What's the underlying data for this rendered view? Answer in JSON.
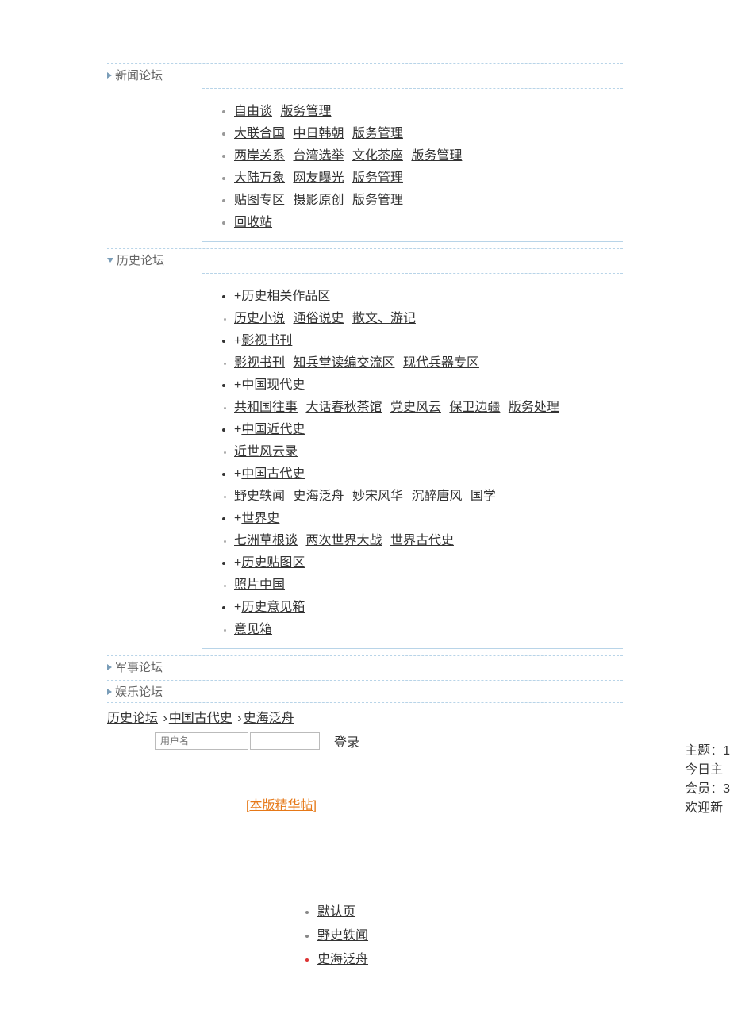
{
  "sections": {
    "news": {
      "title": "新闻论坛"
    },
    "history": {
      "title": "历史论坛"
    },
    "military": {
      "title": "军事论坛"
    },
    "entertainment": {
      "title": "娱乐论坛"
    }
  },
  "news_items": [
    [
      "自由谈",
      "版务管理"
    ],
    [
      "大联合国",
      "中日韩朝",
      "版务管理"
    ],
    [
      "两岸关系",
      "台湾选举",
      "文化茶座",
      "版务管理"
    ],
    [
      "大陆万象",
      "网友曝光",
      "版务管理"
    ],
    [
      "贴图专区",
      "摄影原创",
      "版务管理"
    ],
    [
      "回收站"
    ]
  ],
  "history_groups": [
    {
      "plus": "+",
      "head": "历史相关作品区",
      "items": [
        "历史小说",
        "通俗说史",
        "散文、游记"
      ]
    },
    {
      "plus": "+",
      "head": "影视书刊",
      "items": [
        "影视书刊",
        "知兵堂读编交流区",
        "现代兵器专区"
      ]
    },
    {
      "plus": "+",
      "head": "中国现代史",
      "items": [
        "共和国往事",
        "大话春秋茶馆",
        "党史风云",
        "保卫边疆",
        "版务处理"
      ]
    },
    {
      "plus": "+",
      "head": "中国近代史",
      "items": [
        "近世风云录"
      ]
    },
    {
      "plus": "+",
      "head": "中国古代史",
      "items": [
        "野史轶闻",
        "史海泛舟",
        "妙宋风华",
        "沉醉唐风",
        "国学"
      ]
    },
    {
      "plus": "+",
      "head": "世界史",
      "items": [
        "七洲草根谈",
        "两次世界大战",
        "世界古代史"
      ]
    },
    {
      "plus": "+",
      "head": "历史贴图区",
      "items": [
        "照片中国"
      ]
    },
    {
      "plus": "+",
      "head": "历史意见箱",
      "items": [
        "意见箱"
      ]
    }
  ],
  "breadcrumb": {
    "a": "历史论坛",
    "b": "中国古代史",
    "c": "史海泛舟",
    "sep": "›"
  },
  "login": {
    "username_placeholder": "用户名",
    "login_label": "登录"
  },
  "featured": {
    "open": "[",
    "text": "本版精华帖",
    "close": "]"
  },
  "stats": {
    "line1": "主题：1",
    "line2": "今日主",
    "line3": "会员：3",
    "line4": "欢迎新"
  },
  "tabs": [
    {
      "label": "默认页",
      "active": false
    },
    {
      "label": "野史轶闻",
      "active": false
    },
    {
      "label": "史海泛舟",
      "active": true
    }
  ]
}
